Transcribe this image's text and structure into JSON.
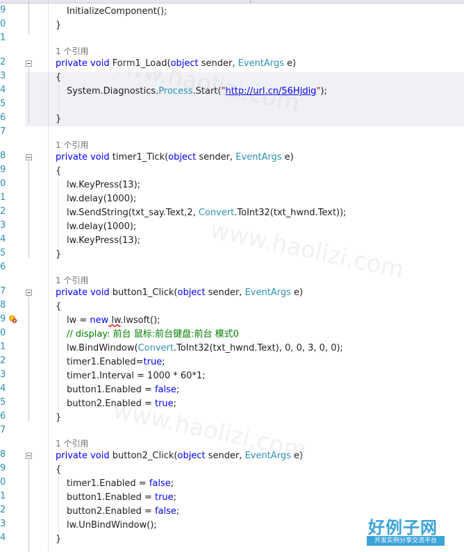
{
  "gutter": {
    "line_numbers": [
      "9",
      "0",
      "1",
      "2",
      "3",
      "4",
      "5",
      "6",
      "7",
      "8",
      "9",
      "0",
      "1",
      "2",
      "3",
      "4",
      "5",
      "6",
      "7",
      "8",
      "9",
      "0",
      "1",
      "2",
      "3",
      "4",
      "5",
      "6",
      "7",
      "8",
      "9",
      "0",
      "1",
      "2",
      "3",
      "4"
    ]
  },
  "lines": {
    "l_init": "InitializeComponent();",
    "l_close1": "}",
    "ref1": "1 个引用",
    "form_sig": {
      "kw1": "private",
      "kw2": "void",
      "name": "Form1_Load",
      "p1": "(",
      "kw3": "object",
      "p2": " sender, ",
      "type": "EventArgs",
      "p3": " e)"
    },
    "form_open": "{",
    "form_body": {
      "a": "System.Diagnostics.",
      "type": "Process",
      "b": ".Start(",
      "q1": "\"",
      "url": "http://url.cn/56Hjdig",
      "q2": "\"",
      "c": ");"
    },
    "form_close": "}",
    "ref2": "1 个引用",
    "timer_sig": {
      "kw1": "private",
      "kw2": "void",
      "name": "timer1_Tick",
      "p1": "(",
      "kw3": "object",
      "p2": " sender, ",
      "type": "EventArgs",
      "p3": " e)"
    },
    "timer_open": "{",
    "timer_b1": "lw.KeyPress(13);",
    "timer_b2": "lw.delay(1000);",
    "timer_b3": {
      "a": "lw.SendString(txt_say.Text,2, ",
      "type": "Convert",
      "b": ".ToInt32(txt_hwnd.Text));"
    },
    "timer_b4": "lw.delay(1000);",
    "timer_b5": "lw.KeyPress(13);",
    "timer_close": "}",
    "ref3": "1 个引用",
    "b1_sig": {
      "kw1": "private",
      "kw2": "void",
      "name": "button1_Click",
      "p1": "(",
      "kw3": "object",
      "p2": " sender, ",
      "type": "EventArgs",
      "p3": " e)"
    },
    "b1_open": "{",
    "b1_l1": {
      "a": "lw = ",
      "kw": "new",
      "b": " lw",
      "c": ".lwsoft();"
    },
    "b1_l2": "// display: 前台 鼠标:前台键盘:前台 模式0",
    "b1_l3": {
      "a": "lw.BindWindow(",
      "type": "Convert",
      "b": ".ToInt32(txt_hwnd.Text), 0, 0, 3, 0, 0);"
    },
    "b1_l4": {
      "a": "timer1.Enabled=",
      "kw": "true",
      "b": ";"
    },
    "b1_l5": "timer1.Interval = 1000 * 60*1;",
    "b1_l6": {
      "a": "button1.Enabled = ",
      "kw": "false",
      "b": ";"
    },
    "b1_l7": {
      "a": "button2.Enabled = ",
      "kw": "true",
      "b": ";"
    },
    "b1_close": "}",
    "ref4": "1 个引用",
    "b2_sig": {
      "kw1": "private",
      "kw2": "void",
      "name": "button2_Click",
      "p1": "(",
      "kw3": "object",
      "p2": " sender, ",
      "type": "EventArgs",
      "p3": " e)"
    },
    "b2_open": "{",
    "b2_l1": {
      "a": "timer1.Enabled = ",
      "kw": "false",
      "b": ";"
    },
    "b2_l2": {
      "a": "button1.Enabled = ",
      "kw": "true",
      "b": ";"
    },
    "b2_l3": {
      "a": "button2.Enabled = ",
      "kw": "false",
      "b": ";"
    },
    "b2_l4": "lw.UnBindWindow();",
    "b2_close": "}"
  },
  "watermark": {
    "text": "www.haolizi.com",
    "logo_big": "好例子网",
    "logo_small": "开发实例分享交流平台"
  },
  "colors": {
    "keyword": "#0000ff",
    "type": "#2b91af",
    "comment": "#008000",
    "link": "#0000ee",
    "line_number": "#2b91af",
    "logo": "#3aa3d8"
  }
}
